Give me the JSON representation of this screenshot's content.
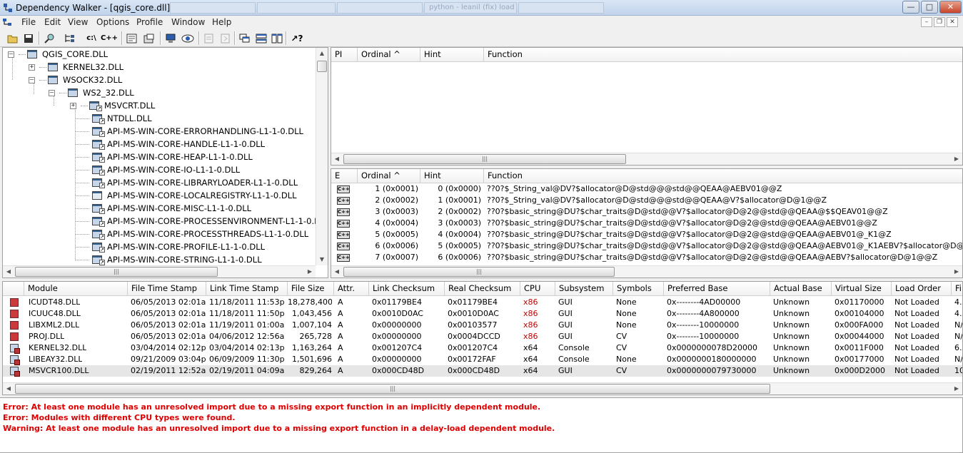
{
  "window": {
    "title": "Dependency Walker - [qgis_core.dll]",
    "background_tabs": [
      "",
      "",
      "",
      "python - leanil (fix) load f...",
      ""
    ]
  },
  "menu": [
    "File",
    "Edit",
    "View",
    "Options",
    "Profile",
    "Window",
    "Help"
  ],
  "tree": {
    "items": [
      {
        "label": "QGIS_CORE.DLL",
        "icon": "module-root-icon"
      },
      {
        "label": "KERNEL32.DLL",
        "icon": "module-icon"
      },
      {
        "label": "WSOCK32.DLL",
        "icon": "module-icon"
      },
      {
        "label": "WS2_32.DLL",
        "icon": "module-icon"
      },
      {
        "label": "MSVCRT.DLL",
        "icon": "module-forward-icon"
      },
      {
        "label": "NTDLL.DLL",
        "icon": "module-forward-icon"
      },
      {
        "label": "API-MS-WIN-CORE-ERRORHANDLING-L1-1-0.DLL",
        "icon": "module-forward-icon"
      },
      {
        "label": "API-MS-WIN-CORE-HANDLE-L1-1-0.DLL",
        "icon": "module-forward-icon"
      },
      {
        "label": "API-MS-WIN-CORE-HEAP-L1-1-0.DLL",
        "icon": "module-forward-icon"
      },
      {
        "label": "API-MS-WIN-CORE-IO-L1-1-0.DLL",
        "icon": "module-forward-icon"
      },
      {
        "label": "API-MS-WIN-CORE-LIBRARYLOADER-L1-1-0.DLL",
        "icon": "module-forward-icon"
      },
      {
        "label": "API-MS-WIN-CORE-LOCALREGISTRY-L1-1-0.DLL",
        "icon": "module-plain-icon"
      },
      {
        "label": "API-MS-WIN-CORE-MISC-L1-1-0.DLL",
        "icon": "module-forward-icon"
      },
      {
        "label": "API-MS-WIN-CORE-PROCESSENVIRONMENT-L1-1-0.D",
        "icon": "module-forward-icon"
      },
      {
        "label": "API-MS-WIN-CORE-PROCESSTHREADS-L1-1-0.DLL",
        "icon": "module-forward-icon"
      },
      {
        "label": "API-MS-WIN-CORE-PROFILE-L1-1-0.DLL",
        "icon": "module-forward-icon"
      },
      {
        "label": "API-MS-WIN-CORE-STRING-L1-1-0.DLL",
        "icon": "module-forward-icon"
      }
    ]
  },
  "imports": {
    "columns": [
      "PI",
      "Ordinal ^",
      "Hint",
      "Function"
    ]
  },
  "exports": {
    "columns": [
      "E",
      "Ordinal ^",
      "Hint",
      "Function"
    ],
    "badge": "C++",
    "rows": [
      {
        "ordinal": "1 (0x0001)",
        "hint": "0 (0x0000)",
        "function": "??0?$_String_val@DV?$allocator@D@std@@@std@@QEAA@AEBV01@@Z"
      },
      {
        "ordinal": "2 (0x0002)",
        "hint": "1 (0x0001)",
        "function": "??0?$_String_val@DV?$allocator@D@std@@@std@@QEAA@V?$allocator@D@1@@Z"
      },
      {
        "ordinal": "3 (0x0003)",
        "hint": "2 (0x0002)",
        "function": "??0?$basic_string@DU?$char_traits@D@std@@V?$allocator@D@2@@std@@QEAA@$$QEAV01@@Z"
      },
      {
        "ordinal": "4 (0x0004)",
        "hint": "3 (0x0003)",
        "function": "??0?$basic_string@DU?$char_traits@D@std@@V?$allocator@D@2@@std@@QEAA@AEBV01@@Z"
      },
      {
        "ordinal": "5 (0x0005)",
        "hint": "4 (0x0004)",
        "function": "??0?$basic_string@DU?$char_traits@D@std@@V?$allocator@D@2@@std@@QEAA@AEBV01@_K1@Z"
      },
      {
        "ordinal": "6 (0x0006)",
        "hint": "5 (0x0005)",
        "function": "??0?$basic_string@DU?$char_traits@D@std@@V?$allocator@D@2@@std@@QEAA@AEBV01@_K1AEBV?$allocator@D@1@@Z"
      },
      {
        "ordinal": "7 (0x0007)",
        "hint": "6 (0x0006)",
        "function": "??0?$basic_string@DU?$char_traits@D@std@@V?$allocator@D@2@@std@@QEAA@AEBV?$allocator@D@1@@Z"
      }
    ]
  },
  "modules": {
    "columns": [
      "Module",
      "File Time Stamp",
      "Link Time Stamp",
      "File Size",
      "Attr.",
      "Link Checksum",
      "Real Checksum",
      "CPU",
      "Subsystem",
      "Symbols",
      "Preferred Base",
      "Actual Base",
      "Virtual Size",
      "Load Order",
      "Fi"
    ],
    "rows": [
      {
        "module": "ICUDT48.DLL",
        "file_ts": "06/05/2013 02:01a",
        "link_ts": "11/18/2011 11:53p",
        "size": "18,278,400",
        "attr": "A",
        "link_ck": "0x01179BE4",
        "real_ck": "0x01179BE4",
        "cpu": "x86",
        "subsystem": "GUI",
        "symbols": "None",
        "pref_base": "0x--------4AD00000",
        "actual_base": "Unknown",
        "vsize": "0x01170000",
        "load_order": "Not Loaded",
        "fi": "4.8",
        "icon": "error-module-icon"
      },
      {
        "module": "ICUUC48.DLL",
        "file_ts": "06/05/2013 02:01a",
        "link_ts": "11/18/2011 11:50p",
        "size": "1,043,456",
        "attr": "A",
        "link_ck": "0x0010D0AC",
        "real_ck": "0x0010D0AC",
        "cpu": "x86",
        "subsystem": "GUI",
        "symbols": "None",
        "pref_base": "0x--------4A800000",
        "actual_base": "Unknown",
        "vsize": "0x00104000",
        "load_order": "Not Loaded",
        "fi": "4.8",
        "icon": "error-module-icon"
      },
      {
        "module": "LIBXML2.DLL",
        "file_ts": "06/05/2013 02:01a",
        "link_ts": "11/19/2011 01:00a",
        "size": "1,007,104",
        "attr": "A",
        "link_ck": "0x00000000",
        "real_ck": "0x00103577",
        "cpu": "x86",
        "subsystem": "GUI",
        "symbols": "None",
        "pref_base": "0x--------10000000",
        "actual_base": "Unknown",
        "vsize": "0x000FA000",
        "load_order": "Not Loaded",
        "fi": "N/",
        "icon": "error-module-icon"
      },
      {
        "module": "PROJ.DLL",
        "file_ts": "06/05/2013 02:01a",
        "link_ts": "04/06/2012 12:56a",
        "size": "265,728",
        "attr": "A",
        "link_ck": "0x00000000",
        "real_ck": "0x0004DCCD",
        "cpu": "x86",
        "subsystem": "GUI",
        "symbols": "CV",
        "pref_base": "0x--------10000000",
        "actual_base": "Unknown",
        "vsize": "0x00044000",
        "load_order": "Not Loaded",
        "fi": "N/",
        "icon": "error-module-icon"
      },
      {
        "module": "KERNEL32.DLL",
        "file_ts": "03/04/2014 02:12p",
        "link_ts": "03/04/2014 02:13p",
        "size": "1,163,264",
        "attr": "A",
        "link_ck": "0x001207C4",
        "real_ck": "0x001207C4",
        "cpu": "x64",
        "subsystem": "Console",
        "symbols": "CV",
        "pref_base": "0x0000000078D20000",
        "actual_base": "Unknown",
        "vsize": "0x0011F000",
        "load_order": "Not Loaded",
        "fi": "6.1",
        "icon": "warning-module-icon"
      },
      {
        "module": "LIBEAY32.DLL",
        "file_ts": "09/21/2009 03:04p",
        "link_ts": "06/09/2009 11:30p",
        "size": "1,501,696",
        "attr": "A",
        "link_ck": "0x00000000",
        "real_ck": "0x00172FAF",
        "cpu": "x64",
        "subsystem": "Console",
        "symbols": "None",
        "pref_base": "0x0000000180000000",
        "actual_base": "Unknown",
        "vsize": "0x00177000",
        "load_order": "Not Loaded",
        "fi": "N/",
        "icon": "warning-module-icon"
      },
      {
        "module": "MSVCR100.DLL",
        "file_ts": "02/19/2011 12:52a",
        "link_ts": "02/19/2011 04:09a",
        "size": "829,264",
        "attr": "A",
        "link_ck": "0x000CD48D",
        "real_ck": "0x000CD48D",
        "cpu": "x64",
        "subsystem": "GUI",
        "symbols": "CV",
        "pref_base": "0x0000000079730000",
        "actual_base": "Unknown",
        "vsize": "0x000D2000",
        "load_order": "Not Loaded",
        "fi": "10",
        "icon": "warning-module-icon"
      }
    ]
  },
  "log": [
    "Error: At least one module has an unresolved import due to a missing export function in an implicitly dependent module.",
    "Error: Modules with different CPU types were found.",
    "Warning: At least one module has an unresolved import due to a missing export function in a delay-load dependent module."
  ],
  "colors": {
    "error": "#e00000",
    "cpu_mismatch": "#c00000",
    "selection": "#e6e6e6"
  }
}
